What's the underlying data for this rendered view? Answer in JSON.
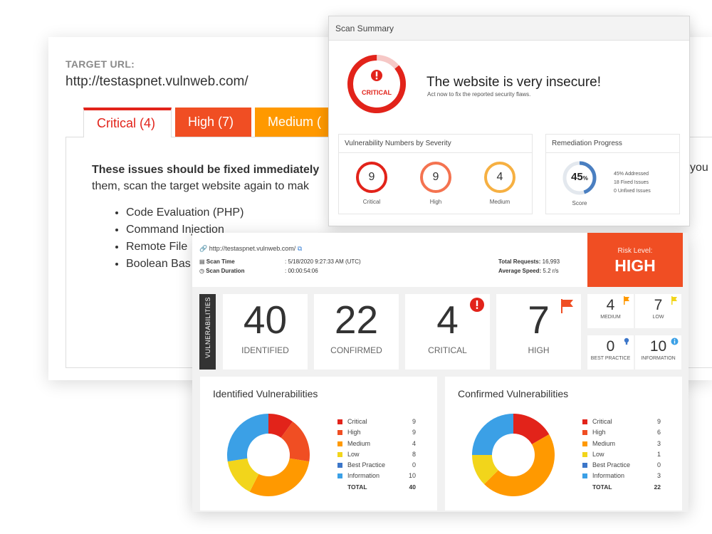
{
  "back": {
    "target_label": "TARGET URL:",
    "target_url": "http://testaspnet.vulnweb.com/",
    "tabs": [
      "Critical (4)",
      "High (7)",
      "Medium ("
    ],
    "heading_bold": "These issues should be fixed immediately",
    "heading_rest": "them, scan the target website again to mak",
    "right_fragment": "you",
    "issues": [
      "Code Evaluation (PHP)",
      "Command Injection",
      "Remote File",
      "Boolean Bas"
    ]
  },
  "summary": {
    "window_title": "Scan Summary",
    "gauge_label": "CRITICAL",
    "headline": "The website is very insecure!",
    "subline": "Act now to fix the reported security flaws.",
    "severity_title": "Vulnerability Numbers by Severity",
    "severity": [
      {
        "label": "Critical",
        "value": "9",
        "color": "#e2231a"
      },
      {
        "label": "High",
        "value": "9",
        "color": "#f47350"
      },
      {
        "label": "Medium",
        "value": "4",
        "color": "#f6b042"
      }
    ],
    "remediation_title": "Remediation Progress",
    "score_value": "45",
    "score_unit": "%",
    "score_caption": "Score",
    "score_fraction": 0.45,
    "stats": [
      "45% Addressed",
      "18 Fixed Issues",
      "0 Unfixed Issues"
    ]
  },
  "dash": {
    "url": "http://testaspnet.vulnweb.com/",
    "scan_time_label": "Scan Time",
    "scan_time_value": ": 5/18/2020 9:27:33 AM (UTC)",
    "scan_duration_label": "Scan Duration",
    "scan_duration_value": ": 00:00:54:06",
    "requests_label": "Total Requests:",
    "requests_value": "16,993",
    "speed_label": "Average Speed:",
    "speed_value": "5.2 r/s",
    "risk_label": "Risk Level:",
    "risk_value": "HIGH",
    "side_label": "VULNERABILITIES",
    "big": [
      {
        "value": "40",
        "label": "IDENTIFIED"
      },
      {
        "value": "22",
        "label": "CONFIRMED"
      },
      {
        "value": "4",
        "label": "CRITICAL"
      },
      {
        "value": "7",
        "label": "HIGH"
      }
    ],
    "small": [
      {
        "value": "4",
        "label": "MEDIUM"
      },
      {
        "value": "7",
        "label": "LOW"
      },
      {
        "value": "0",
        "label": "BEST PRACTICE"
      },
      {
        "value": "10",
        "label": "INFORMATION"
      }
    ]
  },
  "colors": {
    "critical": "#e2231a",
    "high": "#f04e23",
    "medium": "#ff9900",
    "low": "#f2d51b",
    "best_practice": "#3c76c9",
    "information": "#3ba0e6"
  },
  "chart_data": [
    {
      "type": "pie",
      "title": "Identified Vulnerabilities",
      "categories": [
        "Critical",
        "High",
        "Medium",
        "Low",
        "Best Practice",
        "Information"
      ],
      "values": [
        4,
        7,
        12,
        6,
        0,
        11
      ],
      "legend_values": [
        "9",
        "9",
        "4",
        "8",
        "0",
        "10"
      ],
      "total_label": "TOTAL",
      "total_value": "40"
    },
    {
      "type": "pie",
      "title": "Confirmed Vulnerabilities",
      "categories": [
        "Critical",
        "High",
        "Medium",
        "Low",
        "Best Practice",
        "Information"
      ],
      "values": [
        4,
        0,
        11,
        3,
        0,
        6
      ],
      "legend_values": [
        "9",
        "6",
        "3",
        "1",
        "0",
        "3"
      ],
      "total_label": "TOTAL",
      "total_value": "22"
    }
  ]
}
